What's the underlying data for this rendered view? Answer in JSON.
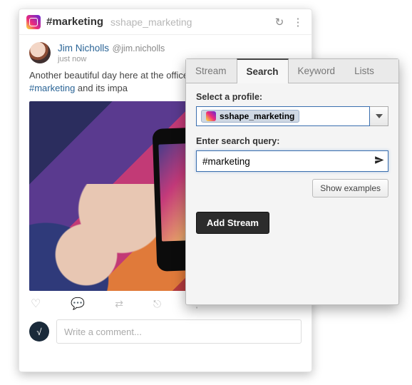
{
  "feed": {
    "header": {
      "icon": "instagram-icon",
      "title": "#marketing",
      "subtitle": "sshape_marketing"
    },
    "post": {
      "author_name": "Jim Nicholls",
      "author_handle": "@jim.nicholls",
      "time": "just now",
      "text_before": "Another beautiful day here at the office! all about digital ",
      "hashtag": "#marketing",
      "text_after": " and its impa"
    },
    "comment_placeholder": "Write a comment..."
  },
  "config": {
    "tabs": [
      "Stream",
      "Search",
      "Keyword",
      "Lists"
    ],
    "active_tab": "Search",
    "profile_label": "Select a profile:",
    "profile_value": "sshape_marketing",
    "query_label": "Enter search query:",
    "query_value": "#marketing",
    "examples_label": "Show examples",
    "add_label": "Add Stream"
  }
}
